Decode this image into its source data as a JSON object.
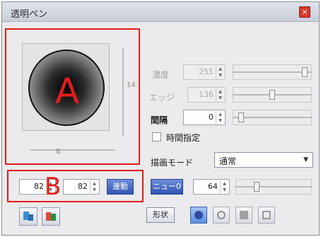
{
  "window": {
    "title": "透明ペン",
    "close_glyph": "×"
  },
  "preview": {
    "vscale_label": "14",
    "hscale_label": "8"
  },
  "annotations": {
    "a": "A",
    "b": "B"
  },
  "controls": {
    "density": {
      "label": "濃度",
      "value": "255"
    },
    "edge": {
      "label": "エッジ",
      "value": "136"
    },
    "interval": {
      "label": "間隔",
      "value": "0"
    },
    "time_spec": {
      "label": "時間指定"
    },
    "draw_mode": {
      "label": "描画モード",
      "selected": "通常"
    },
    "size_w": {
      "value": "82"
    },
    "size_h": {
      "value": "82"
    },
    "link_button": "連動",
    "new_button": "ニュー0",
    "new_value": "64",
    "shape_label": "形状"
  },
  "colors": {
    "annotation": "#e11d1d",
    "active": "#5d8fe0"
  },
  "icons": [
    "close-icon",
    "spin-up-icon",
    "spin-down-icon",
    "dropdown-arrow-icon",
    "circle-shape-icon",
    "ring-shape-icon",
    "square-shape-icon",
    "outline-square-shape-icon",
    "pen-tool-icon",
    "color-tool-icon"
  ]
}
